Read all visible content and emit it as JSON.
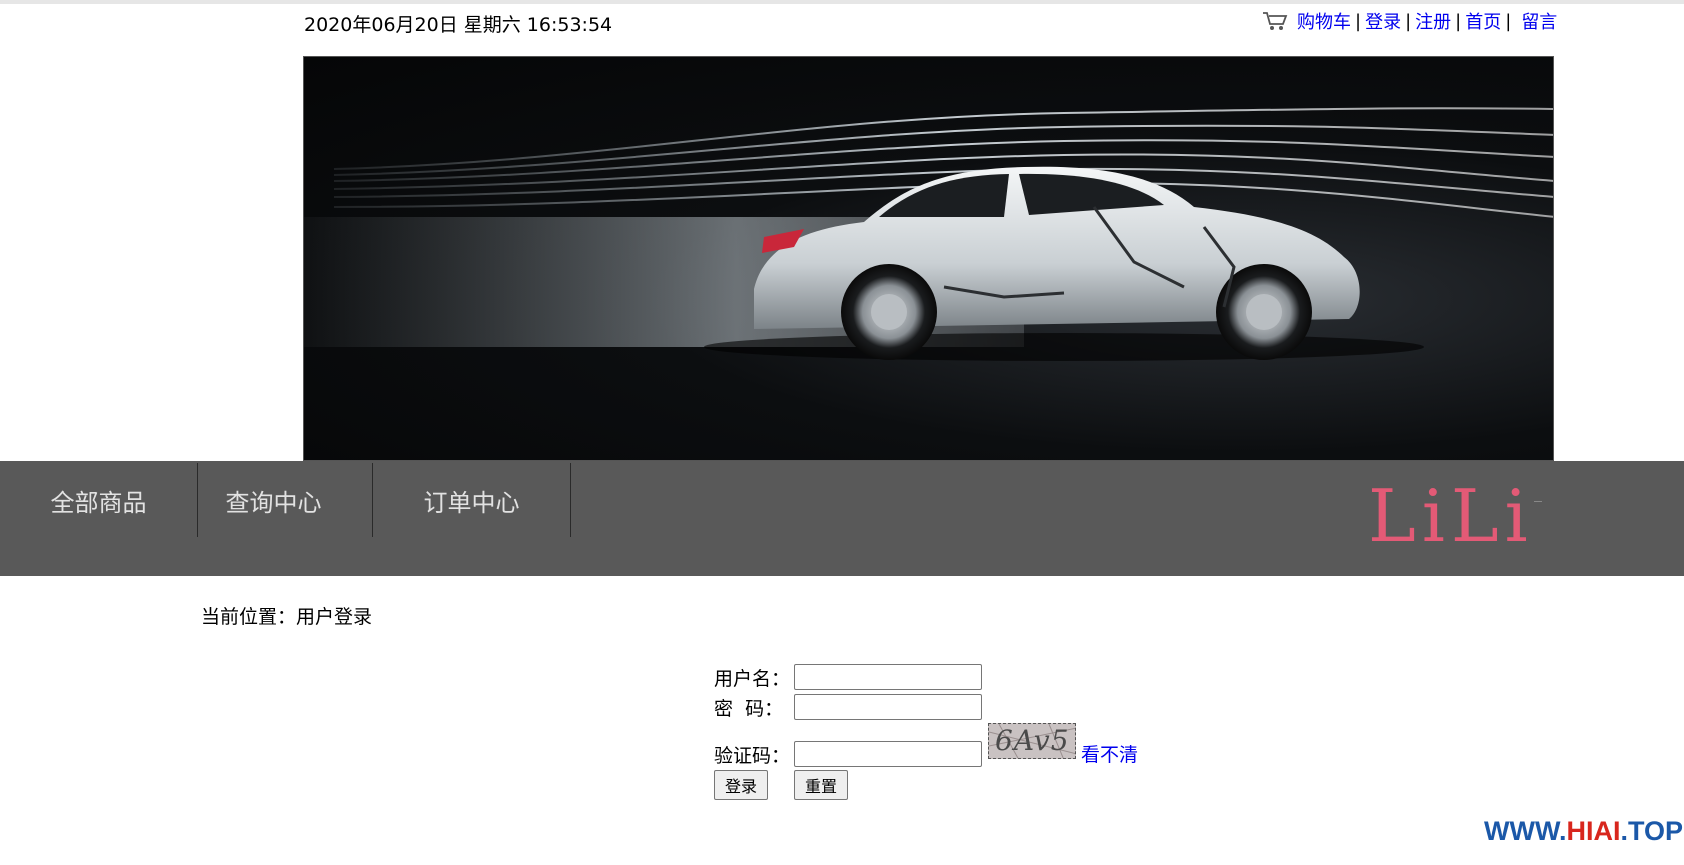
{
  "header": {
    "datetime": "2020年06月20日 星期六 16:53:54",
    "links": {
      "cart": "购物车",
      "login": "登录",
      "register": "注册",
      "home": "首页",
      "message": "留言"
    },
    "separator": "|"
  },
  "banner": {
    "image": "car-wind-tunnel"
  },
  "nav": {
    "items": [
      "全部商品",
      "查询中心",
      "订单中心"
    ],
    "logo": "LiLi"
  },
  "breadcrumb": {
    "label": "当前位置：",
    "current": "用户登录"
  },
  "login_form": {
    "username_label": "用户名：",
    "password_label": "密  码：",
    "captcha_label": "验证码：",
    "username_value": "",
    "password_value": "",
    "captcha_value": "",
    "captcha_image_text": "6Av5",
    "refresh_link": "看不清",
    "submit_button": "登录",
    "reset_button": "重置"
  },
  "watermark": {
    "part1": "WWW.",
    "part2": "HIAI",
    "part3": ".TOP"
  },
  "colors": {
    "nav_bg": "#595959",
    "logo": "#e35a76",
    "link": "#0000ee"
  }
}
